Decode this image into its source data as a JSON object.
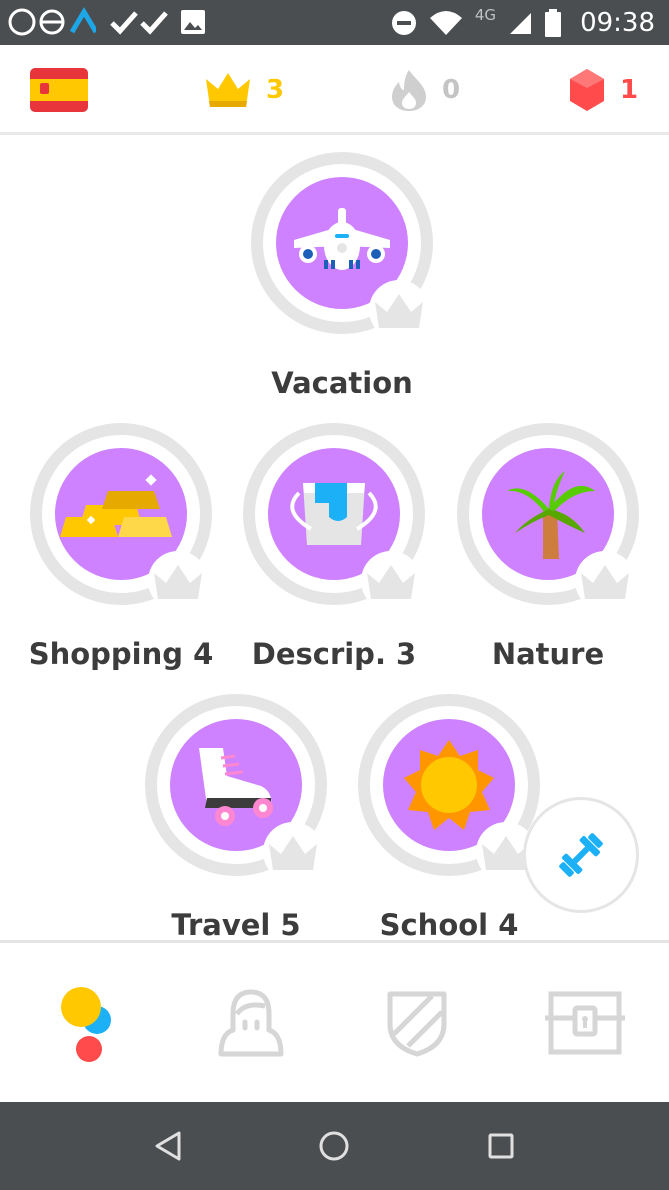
{
  "status_bar": {
    "network": "4G",
    "time": "09:38"
  },
  "header": {
    "language": "Spanish",
    "crowns": "3",
    "streak": "0",
    "gems": "1",
    "colors": {
      "crown": "#ffc800",
      "streak": "#c4c4c4",
      "gems": "#ff4b4b"
    }
  },
  "skills": [
    {
      "label": "Vacation",
      "icon": "airplane-icon",
      "selected": false
    },
    {
      "label": "Shopping 4",
      "icon": "gold-bars-icon",
      "selected": false
    },
    {
      "label": "Descrip. 3",
      "icon": "paint-bucket-icon",
      "selected": false
    },
    {
      "label": "Nature",
      "icon": "palm-tree-icon",
      "selected": false
    },
    {
      "label": "Travel 5",
      "icon": "roller-skate-icon",
      "selected": true
    },
    {
      "label": "School 4",
      "icon": "sun-icon",
      "selected": false
    }
  ],
  "practice_button": {
    "icon": "dumbbell-icon"
  },
  "bottom_nav": [
    {
      "name": "learn",
      "icon": "learn-dots-icon",
      "active": true
    },
    {
      "name": "profile",
      "icon": "profile-icon",
      "active": false
    },
    {
      "name": "leagues",
      "icon": "shield-icon",
      "active": false
    },
    {
      "name": "shop",
      "icon": "treasure-chest-icon",
      "active": false
    }
  ],
  "theme": {
    "skill_fill": "#ce82ff",
    "ring": "#e5e5e5",
    "text": "#3c3c3c"
  }
}
